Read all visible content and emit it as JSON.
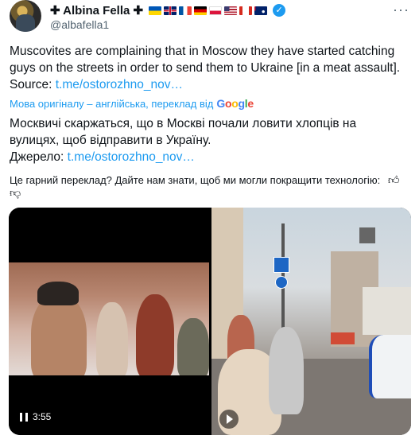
{
  "author": {
    "display_name": "✚ Albina Fella ✚",
    "handle": "@albafella1",
    "flags": [
      {
        "name": "ukraine-flag",
        "colors": [
          "#0057b7",
          "#ffd700"
        ]
      },
      {
        "name": "uk-flag",
        "colors": [
          "#012169",
          "#c8102e"
        ]
      },
      {
        "name": "france-flag",
        "colors": [
          "#0055a4",
          "#ef4135"
        ]
      },
      {
        "name": "germany-flag",
        "colors": [
          "#000000",
          "#dd0000",
          "#ffce00"
        ]
      },
      {
        "name": "poland-flag",
        "colors": [
          "#ffffff",
          "#dc143c"
        ]
      },
      {
        "name": "usa-flag",
        "colors": [
          "#b22234",
          "#3c3b6e"
        ]
      },
      {
        "name": "canada-flag",
        "colors": [
          "#d52b1e",
          "#ffffff"
        ]
      },
      {
        "name": "australia-flag",
        "colors": [
          "#012169",
          "#e4002b"
        ]
      }
    ]
  },
  "tweet": {
    "text": "Muscovites are complaining that in Moscow they have started catching guys on the streets in order to send them to Ukraine [in a meat assault].",
    "source_label": "Source: ",
    "source_link": "t.me/ostorozhno_nov…"
  },
  "translation": {
    "notice": "Мова оригіналу – англійська, переклад від",
    "provider": "Google",
    "text": "Москвичі скаржаться, що в Москві почали ловити хлопців на вулицях, щоб відправити в Україну.",
    "source_label": "Джерело: ",
    "source_link": "t.me/ostorozhno_nov…",
    "feedback_question": "Це гарний переклад? Дайте нам знати, щоб ми могли покращити технологію:"
  },
  "media": {
    "left_video": {
      "duration": "3:55",
      "state": "pause-icon"
    },
    "right_video": {
      "state": "play-icon"
    }
  },
  "colors": {
    "link": "#1d9bf0",
    "verified": "#1d9bf0",
    "secondary_text": "#536471"
  }
}
